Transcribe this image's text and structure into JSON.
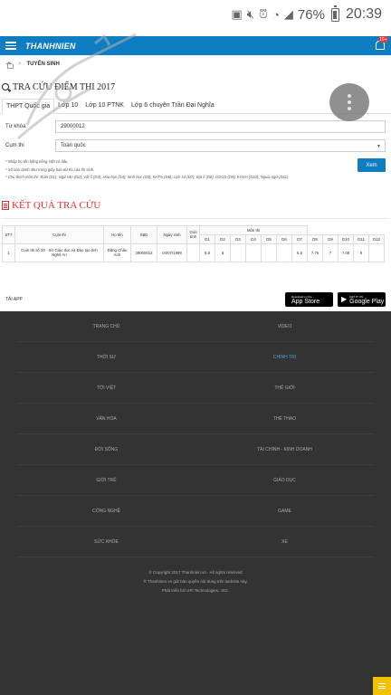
{
  "status": {
    "battery": "76%",
    "time": "20:39"
  },
  "header": {
    "brand": "THANHNIEN",
    "notif_count": "10+"
  },
  "breadcrumb": {
    "item": "TUYỂN SINH"
  },
  "page": {
    "title": "TRA CỨU ĐIỂM THI 2017"
  },
  "tabs": [
    "THPT Quốc gia",
    "Lớp 10",
    "Lớp 10 PTNK",
    "Lớp 6 chuyên Trần Đại Nghĩa"
  ],
  "form": {
    "keyword_label": "Từ khóa",
    "keyword_value": "29000012",
    "cluster_label": "Cụm thi",
    "cluster_value": "Toàn quốc",
    "notes": [
      "* Nhập họ tên bằng tiếng Việt có dấu.",
      "* Số báo danh như trong giấy báo dự thi của thí sinh.",
      "* Chú thích môn thi: Toán (D1); Ngữ văn (D2); Vật lí (D3); Hóa học (D4); Sinh học (D5); KHTN (D6); Lịch sử (D7); Địa lí (D8); GDCD (D9); KHXH (D10); Ngoại ngữ (D11)"
    ],
    "submit": "Xem"
  },
  "results": {
    "title": "KẾT QUẢ TRA CỨU",
    "headers": {
      "stt": "STT",
      "cluster": "Cụm thi",
      "name": "Họ tên",
      "sbd": "SBD",
      "dob": "Ngày sinh",
      "gender": "Giới tính",
      "subjects": "Môn thi"
    },
    "subject_cols": [
      "D1",
      "D2",
      "D3",
      "D4",
      "D5",
      "D6",
      "D7",
      "D8",
      "D9",
      "D10",
      "D11",
      "D12"
    ],
    "rows": [
      {
        "stt": "1",
        "cluster": "Cụm thi số 28 - Sở Giáo dục và Đào tạo tỉnh Nghệ An",
        "name": "Đặng Châu Anh",
        "sbd": "29000012",
        "dob": "04/07/1999",
        "gender": "",
        "scores": [
          "8.8",
          "6",
          "",
          "",
          "",
          "",
          "6.5",
          "7.75",
          "7",
          "7.08",
          "9",
          ""
        ]
      }
    ]
  },
  "app": {
    "label": "TẢI APP",
    "appstore_small": "Download on the",
    "appstore_big": "App Store",
    "googleplay_small": "GET IT ON",
    "googleplay_big": "Google Play"
  },
  "footer": {
    "menu": [
      "TRANG CHỦ",
      "VIDEO",
      "THỜI SỰ",
      "CHÍNH TRỊ",
      "TỚI VIỆT",
      "THẾ GIỚI",
      "VĂN HÓA",
      "THỂ THAO",
      "ĐỜI SỐNG",
      "TÀI CHÍNH - KINH DOANH",
      "GIỚI TRẺ",
      "GIÁO DỤC",
      "CÔNG NGHỆ",
      "GAME",
      "SỨC KHỎE",
      "XE"
    ],
    "active_index": 3,
    "copyright": [
      "© Copyright 2017 Thanhnien.vn - All rights reserved",
      "® Thanhnien.vn giữ bản quyền nội dung trên website này.",
      "Phát triển bởi ePi Technologies, JSC."
    ]
  },
  "colors": {
    "brand_blue": "#0f7dc2",
    "result_red": "#e0302b",
    "footer_bg": "#333333",
    "menu_yellow": "#f2c200"
  }
}
